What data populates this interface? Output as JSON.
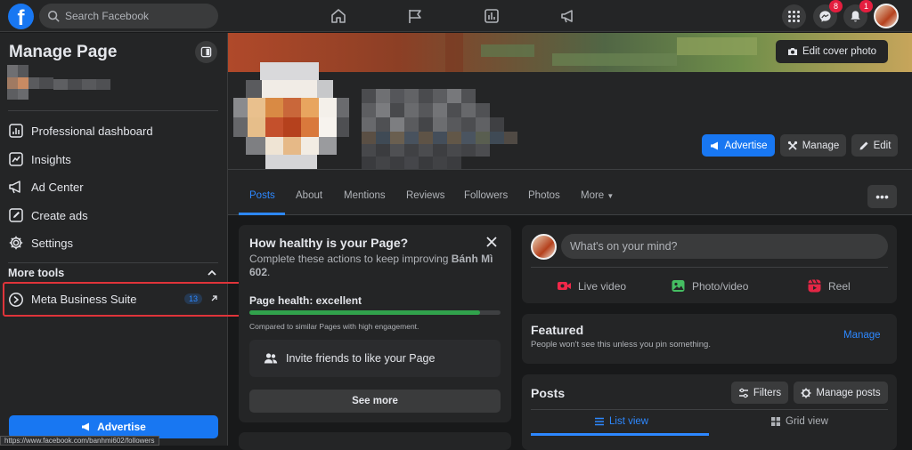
{
  "topbar": {
    "logo": "f",
    "search_placeholder": "Search Facebook",
    "nav_icons": [
      "home-icon",
      "flag-icon",
      "chart-icon",
      "megaphone-icon"
    ],
    "messenger_badge": "8",
    "notifications_badge": "1"
  },
  "sidebar": {
    "title": "Manage Page",
    "items": [
      {
        "label": "Professional dashboard",
        "icon": "dashboard-icon"
      },
      {
        "label": "Insights",
        "icon": "insights-icon"
      },
      {
        "label": "Ad Center",
        "icon": "megaphone-icon"
      },
      {
        "label": "Create ads",
        "icon": "pencil-icon"
      },
      {
        "label": "Settings",
        "icon": "gear-icon"
      }
    ],
    "more_tools_label": "More tools",
    "business_suite": {
      "label": "Meta Business Suite",
      "count": "13"
    },
    "advertise_label": "Advertise"
  },
  "status_url": "https://www.facebook.com/banhmi602/followers",
  "header": {
    "edit_cover_label": "Edit cover photo",
    "advertise_label": "Advertise",
    "manage_label": "Manage",
    "edit_label": "Edit"
  },
  "tabs": [
    "Posts",
    "About",
    "Mentions",
    "Reviews",
    "Followers",
    "Photos",
    "More"
  ],
  "health": {
    "title": "How healthy is your Page?",
    "subtitle_prefix": "Complete these actions to keep improving ",
    "subtitle_page": "Bánh Mì 602",
    "subtitle_suffix": ".",
    "status": "Page health: excellent",
    "progress": 0.92,
    "note": "Compared to similar Pages with high engagement.",
    "invite_label": "Invite friends to like your Page",
    "see_more_label": "See more"
  },
  "composer": {
    "placeholder": "What's on your mind?",
    "options": [
      "Live video",
      "Photo/video",
      "Reel"
    ]
  },
  "featured": {
    "title": "Featured",
    "subtitle": "People won't see this unless you pin something.",
    "manage_label": "Manage"
  },
  "posts": {
    "title": "Posts",
    "filters_label": "Filters",
    "manage_posts_label": "Manage posts",
    "list_view_label": "List view",
    "grid_view_label": "Grid view"
  },
  "colors": {
    "accent": "#1877f2",
    "link": "#2d88ff",
    "highlight_border": "#e0343a",
    "health_bar": "#31a24c"
  }
}
